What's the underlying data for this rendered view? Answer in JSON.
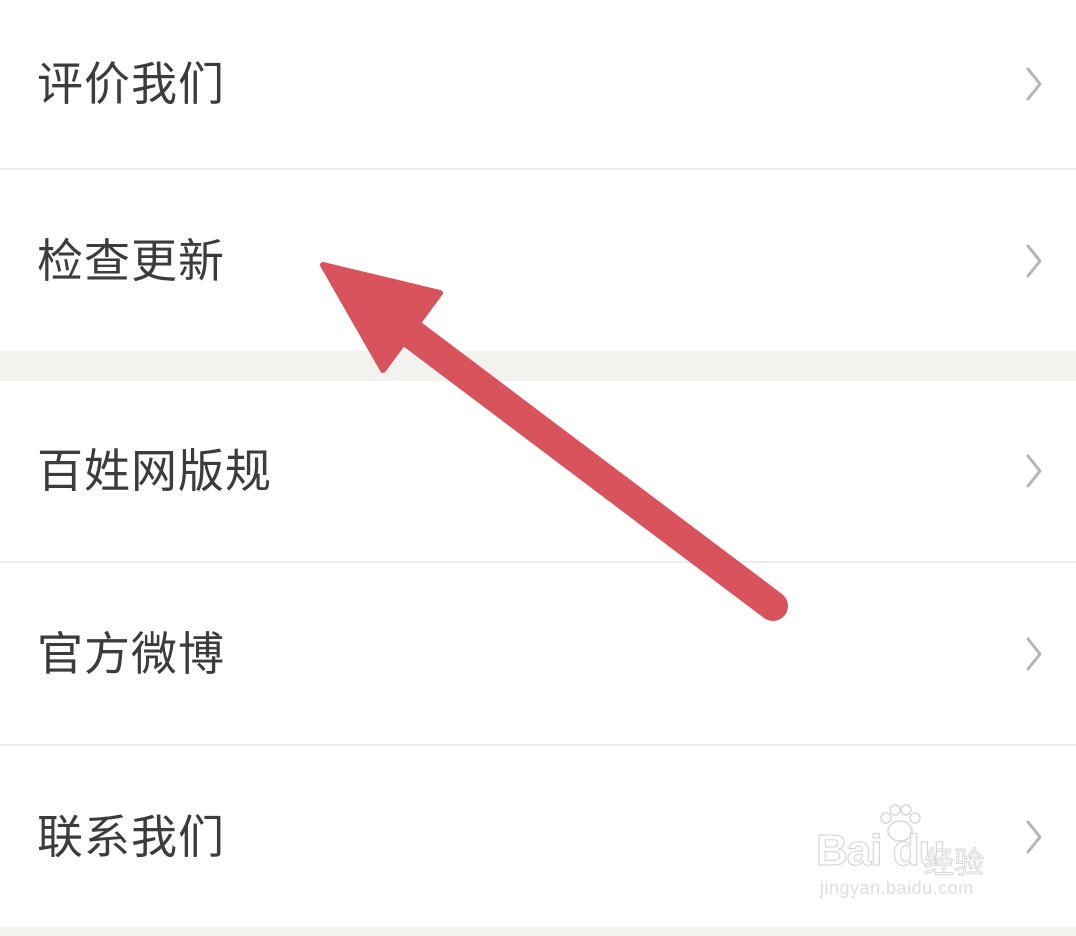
{
  "menu": {
    "items": [
      {
        "label": "评价我们"
      },
      {
        "label": "检查更新"
      },
      {
        "label": "百姓网版规"
      },
      {
        "label": "官方微博"
      },
      {
        "label": "联系我们"
      }
    ]
  },
  "icons": {
    "chevron": "chevron-right-icon",
    "annotation": "arrow-icon"
  },
  "colors": {
    "background": "#ffffff",
    "section_gap": "#f2f2ef",
    "divider": "#ececec",
    "label_text": "#3c3c3c",
    "chevron": "#b5b5b5",
    "arrow": "#d9535c"
  },
  "watermark": {
    "logo": "Bai du",
    "cn": "经验",
    "url": "jingyan.baidu.com"
  }
}
